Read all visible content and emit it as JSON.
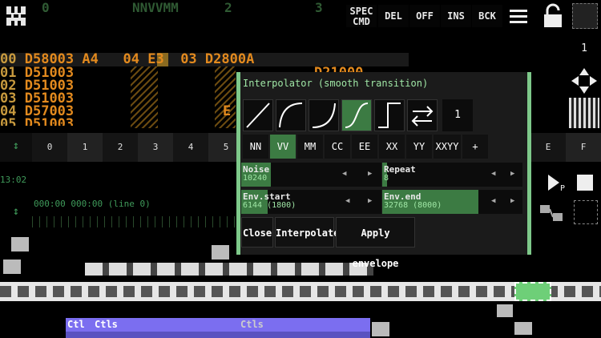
{
  "header": {
    "columns": [
      "0",
      "NNVVMM",
      "2",
      "3"
    ],
    "buttons": {
      "spec_cmd": "SPEC\nCMD",
      "del": "DEL",
      "off": "OFF",
      "ins": "INS",
      "bck": "BCK"
    }
  },
  "pattern": {
    "rows": [
      {
        "num": "00",
        "text": "D58003 A4   04 E3  03 D2800A"
      },
      {
        "num": "01",
        "text": "D51003"
      },
      {
        "num": "02",
        "text": "D51003"
      },
      {
        "num": "03",
        "text": "D51003"
      },
      {
        "num": "04",
        "text": "D57003"
      },
      {
        "num": "05",
        "text": "D51003"
      }
    ],
    "partial_right": "D21000",
    "partial_e": "E"
  },
  "tracks": [
    "0",
    "1",
    "2",
    "3",
    "4",
    "5"
  ],
  "tracks_right": [
    "E",
    "F"
  ],
  "side": {
    "count": "1"
  },
  "timeline": {
    "time": "13:02",
    "position": "000:00 000:00 (line 0)"
  },
  "bottom": {
    "ctl_label": "Ctl",
    "ctls_label_1": "Ctls",
    "ctls_label_2": "Ctls"
  },
  "interpolator": {
    "title": "Interpolator (smooth transition)",
    "curve_count": "1",
    "modes": [
      "NN",
      "VV",
      "MM",
      "CC",
      "EE",
      "XX",
      "YY",
      "XXYY",
      "+"
    ],
    "active_mode": "VV",
    "fields": {
      "noise": {
        "label": "Noise",
        "value": "10240"
      },
      "repeat": {
        "label": "Repeat",
        "value": "8"
      },
      "env_start": {
        "label": "Env.start",
        "value": "6144 (1800)"
      },
      "env_end": {
        "label": "Env.end",
        "value": "32768 (8000)"
      }
    },
    "actions": {
      "close": "Close",
      "interpolate": "Interpolate",
      "apply_envelope": "Apply envelope"
    }
  },
  "colors": {
    "accent_green": "#7ec98a",
    "active_green": "#3c7b43",
    "pattern_orange": "#e38a1e",
    "ctl_purple": "#7b6ef0"
  },
  "icons": [
    "app-logo-icon",
    "menu-icon",
    "lock-icon",
    "square-icon",
    "arrows-icon",
    "qr-icon",
    "play-icon",
    "stop-icon",
    "link-icon"
  ]
}
